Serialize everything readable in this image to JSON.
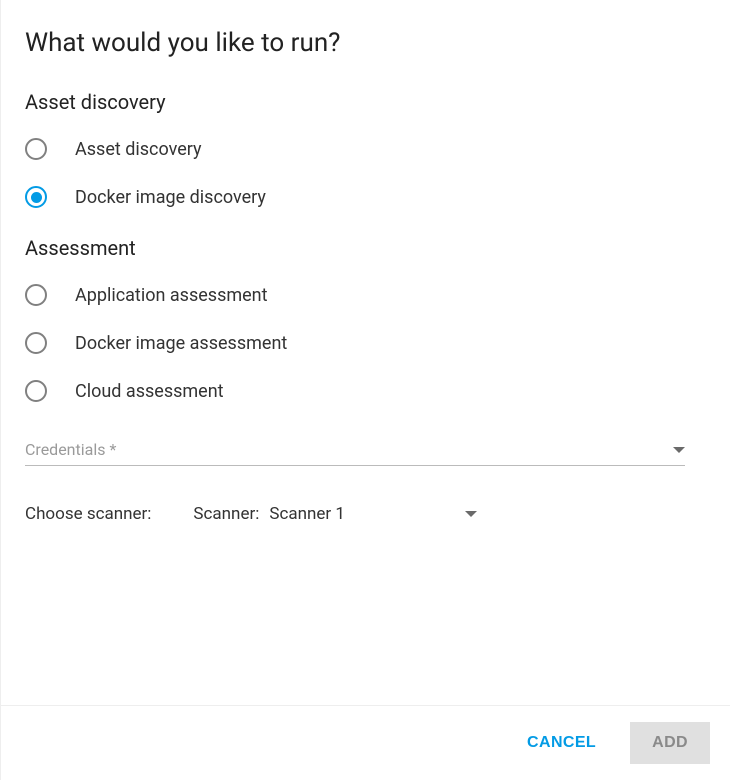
{
  "title": "What would you like to run?",
  "sections": {
    "asset_discovery": {
      "heading": "Asset discovery",
      "options": [
        {
          "label": "Asset discovery",
          "selected": false
        },
        {
          "label": "Docker image discovery",
          "selected": true
        }
      ]
    },
    "assessment": {
      "heading": "Assessment",
      "options": [
        {
          "label": "Application assessment",
          "selected": false
        },
        {
          "label": "Docker image assessment",
          "selected": false
        },
        {
          "label": "Cloud assessment",
          "selected": false
        }
      ]
    }
  },
  "credentials": {
    "label": "Credentials *",
    "value": ""
  },
  "scanner": {
    "choose_label": "Choose scanner:",
    "select_label": "Scanner:",
    "value": "Scanner 1"
  },
  "actions": {
    "cancel": "CANCEL",
    "add": "ADD"
  }
}
